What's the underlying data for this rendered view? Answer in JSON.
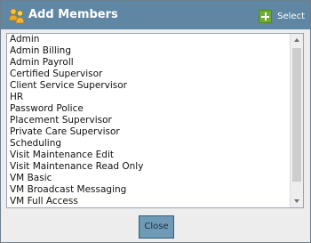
{
  "dialog": {
    "title": "Add Members",
    "title_icon": "people-icon",
    "select_label": "Select",
    "select_icon": "plus-icon"
  },
  "members": {
    "items": [
      "Admin",
      "Admin Billing",
      "Admin Payroll",
      "Certified Supervisor",
      "Client Service Supervisor",
      "HR",
      "Password Police",
      "Placement Supervisor",
      "Private Care Supervisor",
      "Scheduling",
      "Visit Maintenance Edit",
      "Visit Maintenance Read Only",
      "VM Basic",
      "VM Broadcast Messaging",
      "VM Full Access"
    ]
  },
  "footer": {
    "close_label": "Close"
  },
  "colors": {
    "titlebar": "#5f87a4",
    "accent_button": "#6e9ab6",
    "select_icon": "#6fae2c"
  }
}
